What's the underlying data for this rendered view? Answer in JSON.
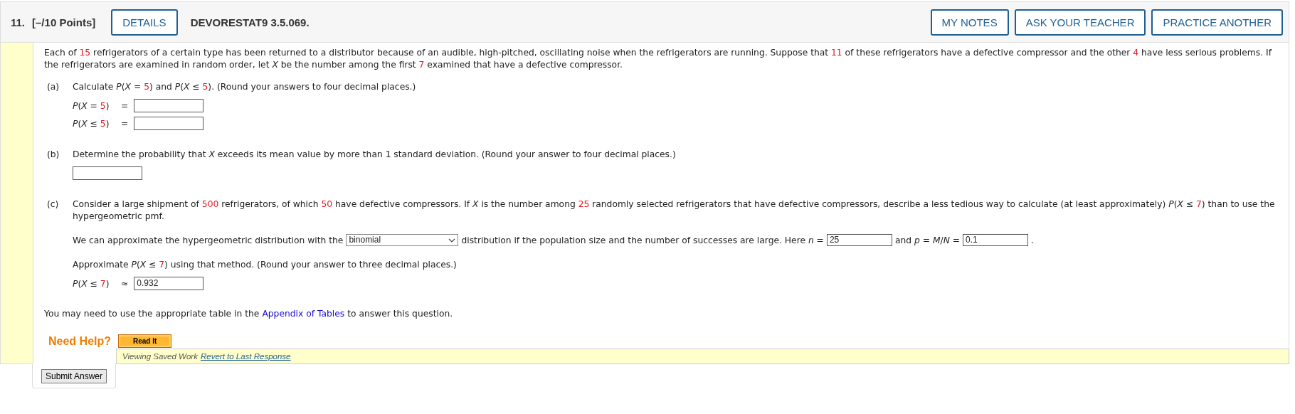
{
  "header": {
    "number": "11.",
    "points": "[–/10 Points]",
    "details_button": "DETAILS",
    "problem_code": "DEVORESTAT9 3.5.069.",
    "buttons": [
      "MY NOTES",
      "ASK YOUR TEACHER",
      "PRACTICE ANOTHER"
    ]
  },
  "intro": [
    {
      "kind": "text",
      "text": "Each of "
    },
    {
      "kind": "value",
      "text": "15"
    },
    {
      "kind": "text",
      "text": " refrigerators of a certain type has been returned to a distributor because of an audible, high-pitched, oscillating noise when the refrigerators are running. Suppose that "
    },
    {
      "kind": "value",
      "text": "11"
    },
    {
      "kind": "text",
      "text": " of these refrigerators have a defective compressor and the other "
    },
    {
      "kind": "value",
      "text": "4"
    },
    {
      "kind": "text",
      "text": " have less serious problems. If the refrigerators are examined in random order, let *X* be the number among the first "
    },
    {
      "kind": "value",
      "text": "7"
    },
    {
      "kind": "text",
      "text": " examined that have a defective compressor."
    }
  ],
  "parts": [
    {
      "label": "(a)",
      "blocks": [
        {
          "kind": "prompt",
          "segments": [
            {
              "kind": "text",
              "text": "Calculate *P*(*X* = "
            },
            {
              "kind": "value",
              "text": "5"
            },
            {
              "kind": "text",
              "text": ") and *P*(*X* ≤ "
            },
            {
              "kind": "value",
              "text": "5"
            },
            {
              "kind": "text",
              "text": "). (Round your answers to four decimal places.)"
            }
          ]
        },
        {
          "kind": "answer",
          "lhs": [
            {
              "kind": "text",
              "text": "*P*(*X* = "
            },
            {
              "kind": "value",
              "text": "5"
            },
            {
              "kind": "text",
              "text": ")"
            }
          ],
          "op": "="
        },
        {
          "kind": "answer",
          "lhs": [
            {
              "kind": "text",
              "text": "*P*(*X* ≤ "
            },
            {
              "kind": "value",
              "text": "5"
            },
            {
              "kind": "text",
              "text": ")"
            }
          ],
          "op": "="
        }
      ]
    },
    {
      "label": "(b)",
      "blocks": [
        {
          "kind": "prompt",
          "segments": [
            {
              "kind": "text",
              "text": "Determine the probability that *X* exceeds its mean value by more than 1 standard deviation. (Round your answer to four decimal places.)"
            }
          ]
        },
        {
          "kind": "field"
        }
      ]
    },
    {
      "label": "(c)",
      "blocks": [
        {
          "kind": "prompt",
          "segments": [
            {
              "kind": "text",
              "text": "Consider a large shipment of "
            },
            {
              "kind": "value",
              "text": "500"
            },
            {
              "kind": "text",
              "text": " refrigerators, of which "
            },
            {
              "kind": "value",
              "text": "50"
            },
            {
              "kind": "text",
              "text": " have defective compressors. If *X* is the number among "
            },
            {
              "kind": "value",
              "text": "25"
            },
            {
              "kind": "text",
              "text": " randomly selected refrigerators that have defective compressors, describe a less tedious way to calculate (at least approximately) *P*(*X* ≤ "
            },
            {
              "kind": "value",
              "text": "7"
            },
            {
              "kind": "text",
              "text": ") than to use the hypergeometric pmf."
            }
          ]
        },
        {
          "kind": "inline",
          "segments": [
            {
              "kind": "text",
              "text": "We can approximate the hypergeometric distribution with the"
            },
            {
              "kind": "select",
              "text": "binomial"
            },
            {
              "kind": "text",
              "text": "distribution if the population size and the number of successes are large. Here *n* ="
            },
            {
              "kind": "input",
              "text": "25"
            },
            {
              "kind": "text",
              "text": "and *p* = *M*/*N* ="
            },
            {
              "kind": "input",
              "text": "0.1"
            },
            {
              "kind": "text",
              "text": "."
            }
          ]
        },
        {
          "kind": "prompt",
          "segments": [
            {
              "kind": "text",
              "text": "Approximate *P*(*X* ≤ "
            },
            {
              "kind": "value",
              "text": "7"
            },
            {
              "kind": "text",
              "text": ") using that method. (Round your answer to three decimal places.)"
            }
          ]
        },
        {
          "kind": "answer",
          "lhs": [
            {
              "kind": "text",
              "text": "*P*(*X* ≤ "
            },
            {
              "kind": "value",
              "text": "7"
            },
            {
              "kind": "text",
              "text": ")"
            }
          ],
          "op": "≈",
          "value": "0.932"
        }
      ]
    }
  ],
  "note": [
    {
      "kind": "text",
      "text": "You may need to use the appropriate table in the"
    },
    {
      "kind": "link",
      "text": "Appendix of Tables"
    },
    {
      "kind": "text",
      "text": "to answer this question."
    }
  ],
  "help": {
    "label": "Need Help?",
    "button": "Read It"
  },
  "footer": {
    "submit": "Submit Answer",
    "status": "Viewing Saved Work",
    "revert_link": "Revert to Last Response"
  }
}
